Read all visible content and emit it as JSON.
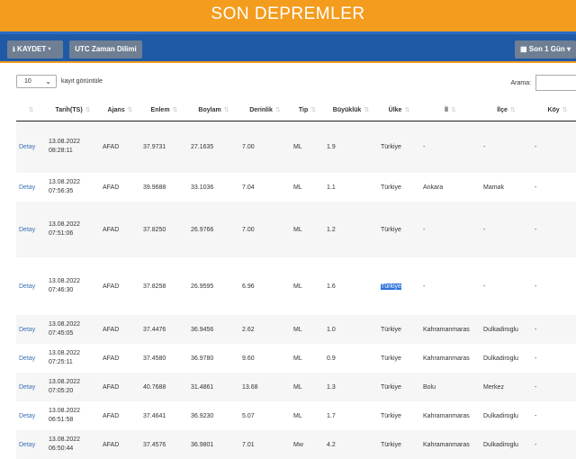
{
  "header": {
    "title": "SON DEPREMLER"
  },
  "toolbar": {
    "save_label": "KAYDET",
    "utc_label": "UTC Zaman Dilimi",
    "range_label": "Son 1 Gün"
  },
  "table_controls": {
    "length_value": "10",
    "length_label": "kayıt görüntüle",
    "search_label": "Arama:"
  },
  "columns": [
    "",
    "Tarih(TS)",
    "Ajans",
    "Enlem",
    "Boylam",
    "Derinlik",
    "Tip",
    "Büyüklük",
    "Ülke",
    "İl",
    "İlçe",
    "Köy"
  ],
  "rows": [
    {
      "link": "Detay",
      "date": "13.08.2022",
      "time": "08:28:11",
      "agency": "AFAD",
      "lat": "37.9731",
      "lon": "27.1635",
      "depth": "7.00",
      "type": "ML",
      "mag": "1.9",
      "country": "Türkiye",
      "city": "-",
      "district": "-",
      "village": "-"
    },
    {
      "link": "Detay",
      "date": "13.08.2022",
      "time": "07:56:35",
      "agency": "AFAD",
      "lat": "39.9688",
      "lon": "33.1036",
      "depth": "7.04",
      "type": "ML",
      "mag": "1.1",
      "country": "Türkiye",
      "city": "Ankara",
      "district": "Mamak",
      "village": "-"
    },
    {
      "link": "Detay",
      "date": "13.08.2022",
      "time": "07:51:06",
      "agency": "AFAD",
      "lat": "37.8250",
      "lon": "26.9766",
      "depth": "7.00",
      "type": "ML",
      "mag": "1.2",
      "country": "Türkiye",
      "city": "-",
      "district": "-",
      "village": "-"
    },
    {
      "link": "Detay",
      "date": "13.08.2022",
      "time": "07:46:30",
      "agency": "AFAD",
      "lat": "37.8258",
      "lon": "26.9595",
      "depth": "6.96",
      "type": "ML",
      "mag": "1.6",
      "country": "Türkiye",
      "city": "-",
      "district": "-",
      "village": "-"
    },
    {
      "link": "Detay",
      "date": "13.08.2022",
      "time": "07:45:05",
      "agency": "AFAD",
      "lat": "37.4476",
      "lon": "36.9456",
      "depth": "2.62",
      "type": "ML",
      "mag": "1.0",
      "country": "Türkiye",
      "city": "Kahramanmaras",
      "district": "Dulkadiroglu",
      "village": "-"
    },
    {
      "link": "Detay",
      "date": "13.08.2022",
      "time": "07:25:11",
      "agency": "AFAD",
      "lat": "37.4580",
      "lon": "36.9780",
      "depth": "9.60",
      "type": "ML",
      "mag": "0.9",
      "country": "Türkiye",
      "city": "Kahramanmaras",
      "district": "Dulkadiroglu",
      "village": "-"
    },
    {
      "link": "Detay",
      "date": "13.08.2022",
      "time": "07:05:20",
      "agency": "AFAD",
      "lat": "40.7688",
      "lon": "31.4861",
      "depth": "13.68",
      "type": "ML",
      "mag": "1.3",
      "country": "Türkiye",
      "city": "Bolu",
      "district": "Merkez",
      "village": "-"
    },
    {
      "link": "Detay",
      "date": "13.08.2022",
      "time": "06:51:58",
      "agency": "AFAD",
      "lat": "37.4641",
      "lon": "36.9230",
      "depth": "5.07",
      "type": "ML",
      "mag": "1.7",
      "country": "Türkiye",
      "city": "Kahramanmaras",
      "district": "Dulkadiroglu",
      "village": "-"
    },
    {
      "link": "Detay",
      "date": "13.08.2022",
      "time": "06:50:44",
      "agency": "AFAD",
      "lat": "37.4576",
      "lon": "36.9801",
      "depth": "7.01",
      "type": "Mw",
      "mag": "4.2",
      "country": "Türkiye",
      "city": "Kahramanmaras",
      "district": "Dulkadiroglu",
      "village": "-"
    }
  ]
}
